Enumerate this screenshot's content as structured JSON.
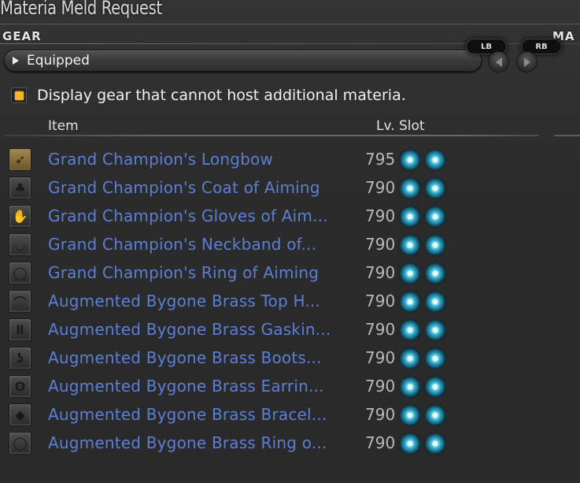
{
  "window": {
    "title": "Materia Meld Request"
  },
  "sections": {
    "gear": "GEAR",
    "right_partial": "MA"
  },
  "filter": {
    "selected": "Equipped",
    "lb_label": "LB",
    "rb_label": "RB"
  },
  "option": {
    "label": "Display gear that cannot host additional materia.",
    "checked": true,
    "accent": "#f4b526"
  },
  "columns": {
    "item": "Item",
    "lv_slot": "Lv. Slot"
  },
  "colors": {
    "item_name": "#5c7fd6",
    "level": "#b9b9b9",
    "materia_slot": "#2f9fbd"
  },
  "items": [
    {
      "name": "Grand Champion's Longbow",
      "level": "795",
      "slots": 2,
      "icon": "longbow-icon"
    },
    {
      "name": "Grand Champion's Coat of Aiming",
      "level": "790",
      "slots": 2,
      "icon": "coat-icon"
    },
    {
      "name": "Grand Champion's Gloves of Aim...",
      "level": "790",
      "slots": 2,
      "icon": "gloves-icon"
    },
    {
      "name": "Grand Champion's Neckband of...",
      "level": "790",
      "slots": 2,
      "icon": "neckband-icon"
    },
    {
      "name": "Grand Champion's Ring of Aiming",
      "level": "790",
      "slots": 2,
      "icon": "ring-icon"
    },
    {
      "name": "Augmented Bygone Brass Top H...",
      "level": "790",
      "slots": 2,
      "icon": "hat-icon"
    },
    {
      "name": "Augmented Bygone Brass Gaskin...",
      "level": "790",
      "slots": 2,
      "icon": "gaskins-icon"
    },
    {
      "name": "Augmented Bygone Brass Boots...",
      "level": "790",
      "slots": 2,
      "icon": "boots-icon"
    },
    {
      "name": "Augmented Bygone Brass Earrin...",
      "level": "790",
      "slots": 2,
      "icon": "earring-icon"
    },
    {
      "name": "Augmented Bygone Brass Bracel...",
      "level": "790",
      "slots": 2,
      "icon": "bracelet-icon"
    },
    {
      "name": "Augmented Bygone Brass Ring o...",
      "level": "790",
      "slots": 2,
      "icon": "ring-icon"
    }
  ]
}
